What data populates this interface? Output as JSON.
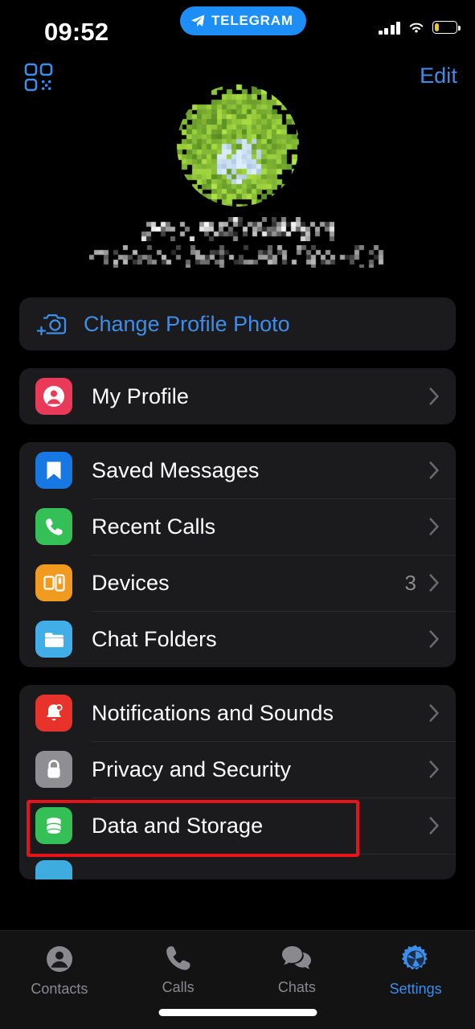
{
  "status_bar": {
    "time": "09:52",
    "island_label": "TELEGRAM",
    "island_icon": "paper-plane-icon",
    "island_color": "#1C8EF5",
    "signal_icon": "cellular-signal-icon",
    "wifi_icon": "wifi-icon",
    "battery_icon": "battery-low-icon",
    "battery_level": 18,
    "battery_color": "#F5C518"
  },
  "nav_bar": {
    "qr_icon": "qr-code-icon",
    "edit_label": "Edit",
    "accent_color": "#3E8DE8"
  },
  "profile": {
    "avatar_icon": "user-avatar-image",
    "name": "",
    "status": "",
    "name_redacted": true,
    "status_redacted": true
  },
  "change_photo": {
    "label": "Change Profile Photo",
    "icon": "camera-plus-icon",
    "color": "#3E8DE8"
  },
  "groups": [
    {
      "id": "profile-group",
      "rows": [
        {
          "id": "my-profile",
          "label": "My Profile",
          "icon": "person-circle-icon",
          "icon_color": "#E93A5A",
          "value": "",
          "chevron": true
        }
      ]
    },
    {
      "id": "messages-group",
      "rows": [
        {
          "id": "saved-messages",
          "label": "Saved Messages",
          "icon": "bookmark-icon",
          "icon_color": "#1777E3",
          "value": "",
          "chevron": true
        },
        {
          "id": "recent-calls",
          "label": "Recent Calls",
          "icon": "phone-icon",
          "icon_color": "#34C056",
          "value": "",
          "chevron": true
        },
        {
          "id": "devices",
          "label": "Devices",
          "icon": "devices-icon",
          "icon_color": "#F09A20",
          "value": "3",
          "chevron": true
        },
        {
          "id": "chat-folders",
          "label": "Chat Folders",
          "icon": "folder-icon",
          "icon_color": "#42AEE8",
          "value": "",
          "chevron": true
        }
      ]
    },
    {
      "id": "settings-group",
      "rows": [
        {
          "id": "notifications-and-sounds",
          "label": "Notifications and Sounds",
          "icon": "bell-icon",
          "icon_color": "#E8332C",
          "value": "",
          "chevron": true
        },
        {
          "id": "privacy-and-security",
          "label": "Privacy and Security",
          "icon": "lock-icon",
          "icon_color": "#8E8E93",
          "value": "",
          "chevron": true
        },
        {
          "id": "data-and-storage",
          "label": "Data and Storage",
          "icon": "database-icon",
          "icon_color": "#34C056",
          "value": "",
          "chevron": true
        }
      ]
    }
  ],
  "clipped_row": {
    "id": "appearance",
    "icon": "appearance-icon",
    "icon_color": "#3FACE0"
  },
  "annotation": {
    "target": "privacy-and-security",
    "color": "#E8121A"
  },
  "tab_bar": {
    "tabs": [
      {
        "id": "contacts",
        "label": "Contacts",
        "icon": "contacts-icon",
        "active": false
      },
      {
        "id": "calls",
        "label": "Calls",
        "icon": "phone-icon",
        "active": false
      },
      {
        "id": "chats",
        "label": "Chats",
        "icon": "chats-icon",
        "active": false
      },
      {
        "id": "settings",
        "label": "Settings",
        "icon": "gear-icon",
        "active": true
      }
    ],
    "active_color": "#3E8DE8",
    "inactive_color": "#8A8A8E"
  }
}
